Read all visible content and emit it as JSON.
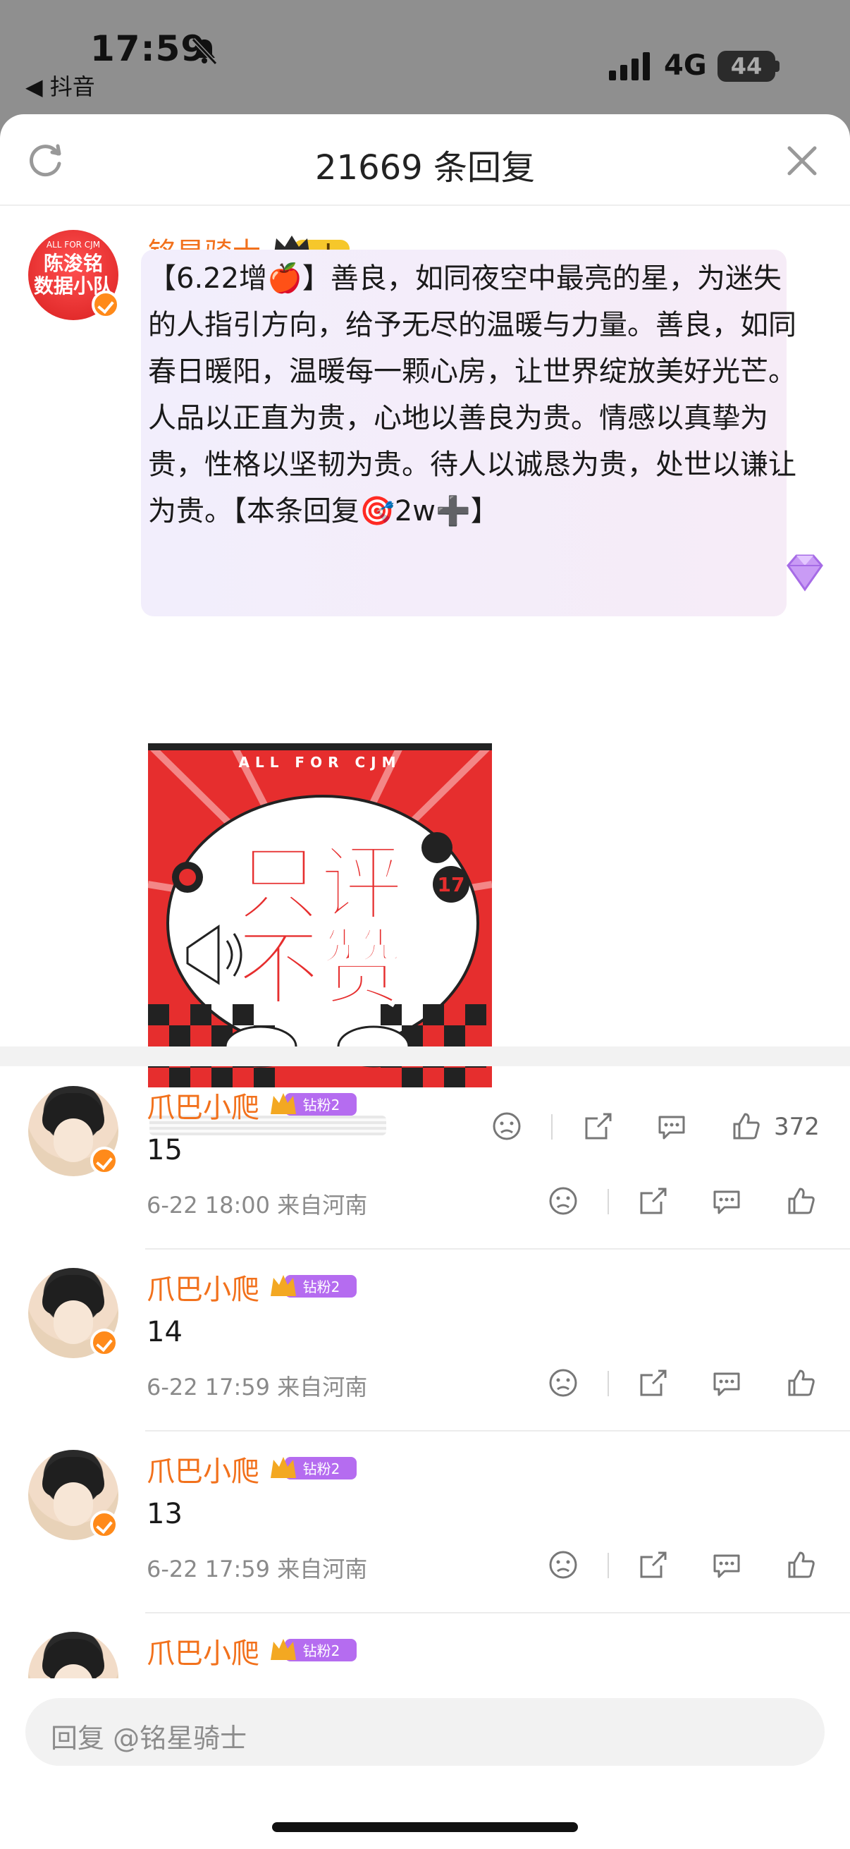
{
  "status_bar": {
    "time": "17:59",
    "back_app": "◀ 抖音",
    "network": "4G",
    "battery": "44"
  },
  "sheet": {
    "title": "21669 条回复"
  },
  "main_comment": {
    "username": "铭星骑士",
    "level_badge": "I",
    "avatar_text": {
      "top": "ALL FOR CJM",
      "line1": "陈浚铭",
      "line2": "数据小队"
    },
    "text": "【6.22增🍎】善良，如同夜空中最亮的星，为迷失的人指引方向，给予无尽的温暖与力量。善良，如同春日暖阳，温暖每一颗心房，让世界绽放美好光芒。人品以正直为贵，心地以善良为贵。情感以真挚为贵，性格以坚韧为贵。待人以诚恳为贵，处世以谦让为贵。【本条回复🎯2w➕】",
    "image": {
      "banner": "ALL FOR CJM",
      "line1": "只评",
      "line2": "不赞",
      "num_a": "17"
    },
    "like_count": "372"
  },
  "replies": [
    {
      "username": "爪巴小爬",
      "badge": "钻粉2",
      "text": "15",
      "meta": "6-22 18:00  来自河南"
    },
    {
      "username": "爪巴小爬",
      "badge": "钻粉2",
      "text": "14",
      "meta": "6-22 17:59  来自河南"
    },
    {
      "username": "爪巴小爬",
      "badge": "钻粉2",
      "text": "13",
      "meta": "6-22 17:59  来自河南"
    },
    {
      "username": "爪巴小爬",
      "badge": "钻粉2",
      "text": "",
      "meta": ""
    }
  ],
  "input": {
    "placeholder": "回复 @铭星骑士"
  },
  "colors": {
    "accent_orange": "#f2711c",
    "bubble_lavender": "#f2eefc",
    "badge_purple": "#b56cf0"
  }
}
